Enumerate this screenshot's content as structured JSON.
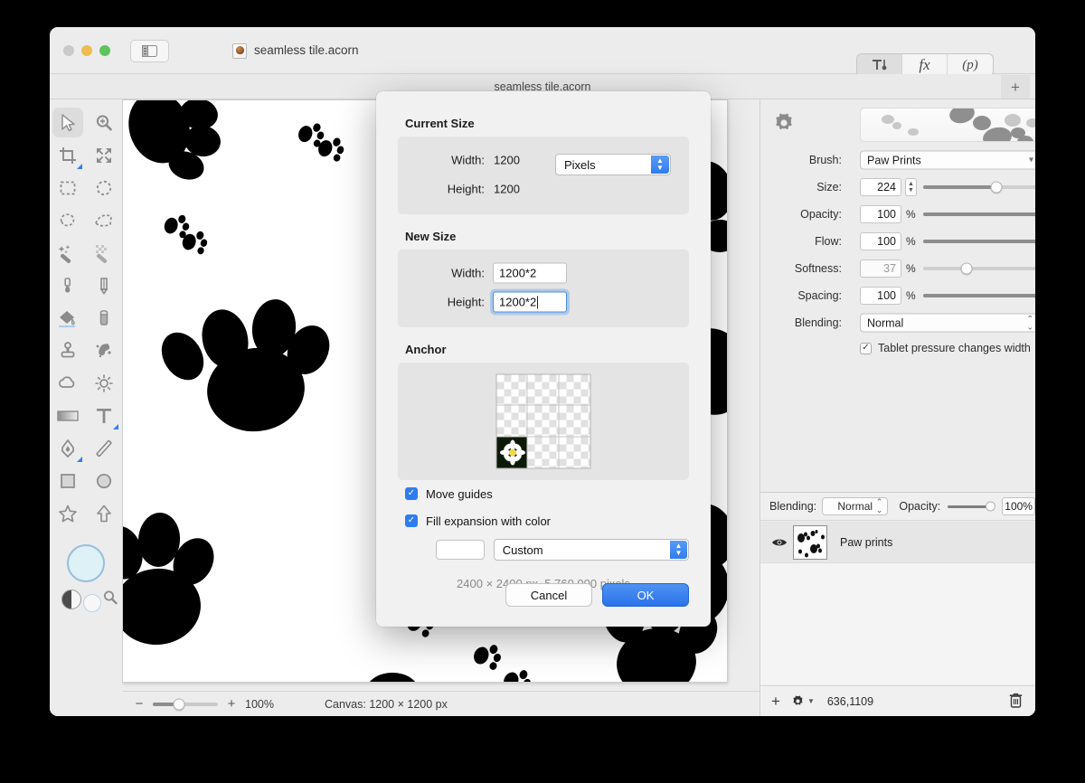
{
  "window": {
    "traffic": {
      "close": "close-button",
      "minimize": "minimize-button",
      "maximize": "maximize-button"
    },
    "doc_title": "seamless tile.acorn",
    "tab_label": "seamless tile.acorn",
    "tab_add_label": "+",
    "toolbar_segments": [
      {
        "name": "tools-toggle",
        "glyph": "",
        "active": true
      },
      {
        "name": "filters-fx",
        "glyph": "fx",
        "active": false
      },
      {
        "name": "presets-p",
        "glyph": "(p)",
        "active": false
      }
    ]
  },
  "tools": [
    {
      "name": "move-tool",
      "icon": "cursor-arrow-icon",
      "selected": true,
      "corner": false
    },
    {
      "name": "zoom-tool",
      "icon": "magnifier-plus-icon",
      "selected": false,
      "corner": false
    },
    {
      "name": "crop-tool",
      "icon": "crop-icon",
      "selected": false,
      "corner": true
    },
    {
      "name": "transform-tool",
      "icon": "arrows-expand-icon",
      "selected": false,
      "corner": false
    },
    {
      "name": "rectangular-select-tool",
      "icon": "marquee-rect-icon",
      "selected": false,
      "corner": false
    },
    {
      "name": "elliptical-select-tool",
      "icon": "marquee-ellipse-icon",
      "selected": false,
      "corner": false
    },
    {
      "name": "lasso-tool",
      "icon": "lasso-icon",
      "selected": false,
      "corner": false
    },
    {
      "name": "polygon-select-tool",
      "icon": "polygon-lasso-icon",
      "selected": false,
      "corner": false
    },
    {
      "name": "magic-wand-tool",
      "icon": "magic-wand-icon",
      "selected": false,
      "corner": false
    },
    {
      "name": "instant-alpha-tool",
      "icon": "instant-alpha-icon",
      "selected": false,
      "corner": false
    },
    {
      "name": "smudge-tool",
      "icon": "smudge-icon",
      "selected": false,
      "corner": false
    },
    {
      "name": "pencil-tool",
      "icon": "pencil-icon",
      "selected": false,
      "corner": false
    },
    {
      "name": "paint-bucket-tool",
      "icon": "paint-bucket-icon",
      "selected": false,
      "corner": true
    },
    {
      "name": "eraser-tool",
      "icon": "eraser-icon",
      "selected": false,
      "corner": false
    },
    {
      "name": "clone-stamp-tool",
      "icon": "clone-stamp-icon",
      "selected": false,
      "corner": false
    },
    {
      "name": "healing-brush-tool",
      "icon": "healing-sparkle-icon",
      "selected": false,
      "corner": false
    },
    {
      "name": "blur-tool",
      "icon": "cloud-icon",
      "selected": false,
      "corner": false
    },
    {
      "name": "dodge-tool",
      "icon": "sun-icon",
      "selected": false,
      "corner": false
    },
    {
      "name": "gradient-tool",
      "icon": "gradient-icon",
      "selected": false,
      "corner": false
    },
    {
      "name": "text-tool",
      "icon": "text-t-icon",
      "selected": false,
      "corner": true
    },
    {
      "name": "bezier-pen-tool",
      "icon": "pen-nib-icon",
      "selected": false,
      "corner": true
    },
    {
      "name": "line-tool",
      "icon": "line-icon",
      "selected": false,
      "corner": false
    },
    {
      "name": "rectangle-shape-tool",
      "icon": "square-icon",
      "selected": false,
      "corner": false
    },
    {
      "name": "ellipse-shape-tool",
      "icon": "circle-icon",
      "selected": false,
      "corner": false
    },
    {
      "name": "star-shape-tool",
      "icon": "star-icon",
      "selected": false,
      "corner": false
    },
    {
      "name": "arrow-shape-tool",
      "icon": "arrow-up-icon",
      "selected": false,
      "corner": false
    }
  ],
  "statusbar": {
    "zoom_minus": "−",
    "zoom_plus": "+",
    "zoom_value": "100%",
    "canvas_size": "Canvas: 1200 × 1200 px"
  },
  "inspector": {
    "gear": "gear-icon",
    "brush_label": "Brush:",
    "brush_value": "Paw Prints",
    "size_label": "Size:",
    "size_value": "224",
    "opacity_label": "Opacity:",
    "opacity_value": "100",
    "flow_label": "Flow:",
    "flow_value": "100",
    "softness_label": "Softness:",
    "softness_value": "37",
    "spacing_label": "Spacing:",
    "spacing_value": "100",
    "blending_label": "Blending:",
    "blending_value": "Normal",
    "percent_sign": "%",
    "tablet_label": "Tablet pressure changes width",
    "tablet_checked": "✓"
  },
  "layers": {
    "blending_label": "Blending:",
    "blending_value": "Normal",
    "opacity_label": "Opacity:",
    "opacity_value": "100%",
    "rows": [
      {
        "name": "Paw prints",
        "visible": true
      }
    ],
    "footer": {
      "add": "+",
      "gear": "gear-icon",
      "coords": "636,1109",
      "trash": "trash-icon"
    }
  },
  "dialog": {
    "current_size_heading": "Current Size",
    "current_width_label": "Width:",
    "current_width_value": "1200",
    "current_height_label": "Height:",
    "current_height_value": "1200",
    "unit_value": "Pixels",
    "new_size_heading": "New Size",
    "new_width_label": "Width:",
    "new_width_value": "1200*2",
    "new_height_label": "Height:",
    "new_height_value": "1200*2",
    "anchor_heading": "Anchor",
    "move_guides_label": "Move guides",
    "fill_expansion_label": "Fill expansion with color",
    "fill_color_preset": "Custom",
    "summary": "2400 × 2400 px, 5,760,000 pixels",
    "cancel_label": "Cancel",
    "ok_label": "OK"
  },
  "colors": {
    "accent_blue": "#2f7cf0",
    "ok_button": "#3a82ee",
    "window_bg": "#ececec",
    "dialog_bg": "#f1f1f1",
    "group_bg": "#e4e4e4",
    "foreground_swatch": "#ddf1f6"
  }
}
